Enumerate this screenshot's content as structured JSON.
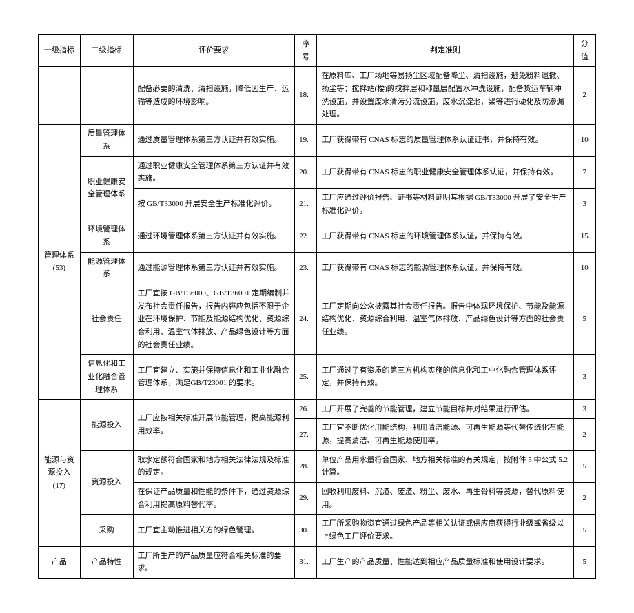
{
  "headers": {
    "lv1": "一级指标",
    "lv2": "二级指标",
    "req": "评价要求",
    "seq": "序号",
    "crit": "判定准则",
    "score": "分值"
  },
  "groups": {
    "mgmt": "管理体系(53)",
    "energy_res": "能源与资源投入(17)",
    "product": "产品"
  },
  "lv2": {
    "quality": "质量管理体系",
    "ohs": "职业健康安全管理体系",
    "env": "环境管理体系",
    "ems": "能源管理体系",
    "csr": "社会责任",
    "info": "信息化和工业化融合管理体系",
    "energy_in": "能源投入",
    "res_in": "资源投入",
    "procure": "采购",
    "prod_attr": "产品特性"
  },
  "rows": {
    "r18": {
      "req": "配备必要的清洗、清扫设施，降低因生产、运输等造成的环境影响。",
      "seq": "18.",
      "crit": "在原料库、工厂场地等易扬尘区域配备降尘、清扫设施，避免粉料遗撒、扬尘等；搅拌站(楼)的搅拌层和称量层配置水冲洗设施，配备货运车辆冲洗设施，并设置废水清污分流设施，废水沉淀池，梁等进行硬化及防渗漏处理。",
      "score": "2"
    },
    "r19": {
      "req": "通过质量管理体系第三方认证并有效实施。",
      "seq": "19.",
      "crit": "工厂获得带有 CNAS 标志的质量管理体系认证证书，并保持有效。",
      "score": "10"
    },
    "r20": {
      "req": "通过职业健康安全管理体系第三方认证并有效实施。",
      "seq": "20.",
      "crit": "工厂获得带有 CNAS 标志的职业健康安全管理体系认证，并保持有效。",
      "score": "7"
    },
    "r21": {
      "req": "按 GB/T33000 开展安全生产标准化评价。",
      "seq": "21.",
      "crit": "工厂应通过评价报告、证书等材料证明其根据 GB/T33000 开展了安全生产标准化评价。",
      "score": "3"
    },
    "r22": {
      "req": "通过环境管理体系第三方认证并有效实施。",
      "seq": "22.",
      "crit": "工厂获得带有 CNAS 标志的环境管理体系认证，并保持有效。",
      "score": "15"
    },
    "r23": {
      "req": "通过能源管理体系第三方认证并有效实施。",
      "seq": "23.",
      "crit": "工厂获得带有 CNAS 标志的能源管理体系认证，并保持有效。",
      "score": "10"
    },
    "r24": {
      "req": "工厂宜按 GB/T36000、GB/T36001 定期编制并发布社会责任报告，报告内容应包括不限于企业在环境保护、节能及能源结构优化、资源综合利用、温室气体排放、产品绿色设计等方面的社会责任业绩。",
      "seq": "24.",
      "crit": "工厂定期向公众披露其社会责任报告。报告中体现环境保护、节能及能源结构优化、资源综合利用、温室气体排放、产品绿色设计等方面的社会责任业绩。",
      "score": "5"
    },
    "r25": {
      "req": "工厂宜建立、实施并保持信息化和工业化融合管理体系，满足GB/T23001 的要求。",
      "seq": "25.",
      "crit": "工厂通过了有资质的第三方机构实施的信息化和工业化融合管理体系评定，并保持有效。",
      "score": "3"
    },
    "r26": {
      "req": "工厂应按相关标准开展节能管理，提高能源利用效率。",
      "seq": "26.",
      "crit": "工厂开展了完善的节能管理，建立节能目标并对结果进行评估。",
      "score": "3"
    },
    "r27": {
      "seq": "27.",
      "crit": "工厂宜不断优化用能结构，利用清洁能源、可再生能源等代替传统化石能源，提高清洁、可再生能源使用率。",
      "score": "2"
    },
    "r28": {
      "req": "取水定额符合国家和地方相关法律法规及标准的规定。",
      "seq": "28.",
      "crit": "单位产品用水量符合国家、地方相关标准的有关规定，按附件 5 中公式 5.2 计算。",
      "score": "5"
    },
    "r29": {
      "req": "在保证产品质量和性能的条件下，通过资源综合利用提高原料替代率。",
      "seq": "29.",
      "crit": "回收利用废料、沉渣、废渣、粉尘、废水、再生骨料等资源，替代原料使用。",
      "score": "2"
    },
    "r30": {
      "req": "工厂宜主动推进相关方的绿色管理。",
      "seq": "30.",
      "crit": "工厂所采购物资宜通过绿色产品等相关认证或供应商获得行业级或省级以上绿色工厂评价要求。",
      "score": "5"
    },
    "r31": {
      "req": "工厂所生产的产品质量应符合相关标准的要求。",
      "seq": "31.",
      "crit": "工厂生产的产品质量、性能达到相应产品质量标准和使用设计要求。",
      "score": "5"
    }
  }
}
